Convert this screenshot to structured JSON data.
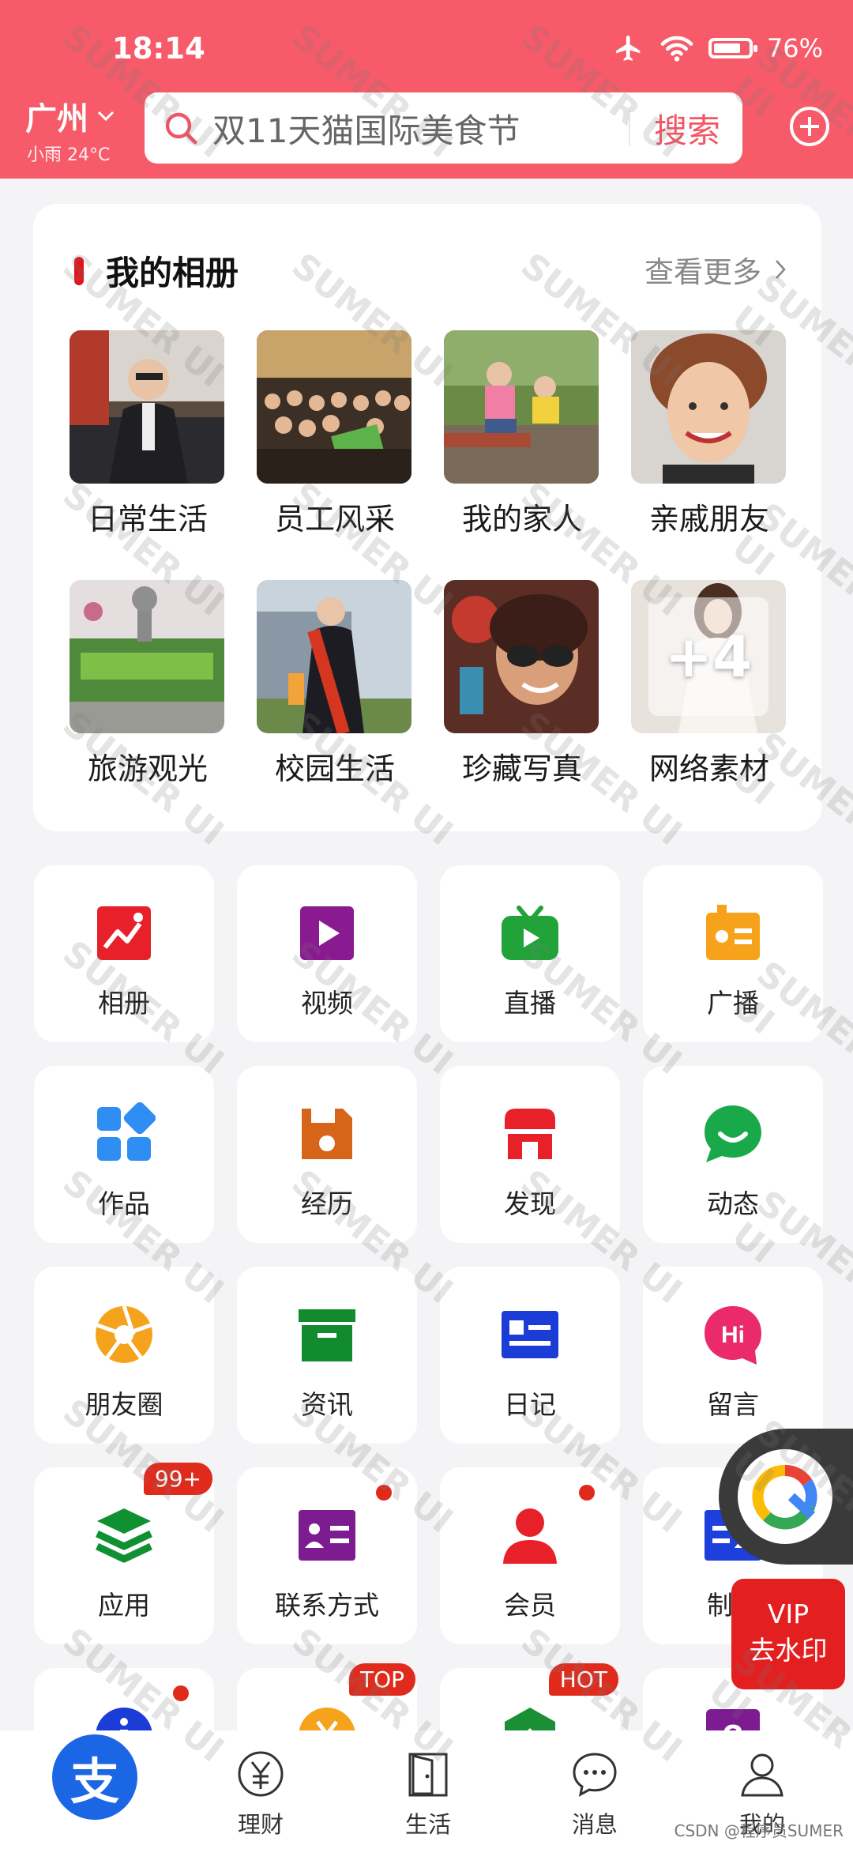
{
  "status_bar": {
    "time": "18:14",
    "battery": "76%",
    "battery_level": 0.76
  },
  "header": {
    "city": "广州",
    "weather": "小雨 24°C",
    "search_placeholder": "双11天猫国际美食节",
    "search_button": "搜索"
  },
  "album": {
    "title": "我的相册",
    "more": "查看更多",
    "items": [
      {
        "label": "日常生活"
      },
      {
        "label": "员工风采"
      },
      {
        "label": "我的家人"
      },
      {
        "label": "亲戚朋友"
      },
      {
        "label": "旅游观光"
      },
      {
        "label": "校园生活"
      },
      {
        "label": "珍藏写真"
      },
      {
        "label": "网络素材",
        "overlay": "+4"
      }
    ]
  },
  "grid": {
    "items": [
      {
        "label": "相册",
        "icon": "album-icon",
        "color": "#e8202a"
      },
      {
        "label": "视频",
        "icon": "video-icon",
        "color": "#8a1a8f"
      },
      {
        "label": "直播",
        "icon": "live-tv-icon",
        "color": "#22a33a"
      },
      {
        "label": "广播",
        "icon": "radio-icon",
        "color": "#f7a21b"
      },
      {
        "label": "作品",
        "icon": "works-icon",
        "color": "#2f8ef3"
      },
      {
        "label": "经历",
        "icon": "save-disk-icon",
        "color": "#d6651a"
      },
      {
        "label": "发现",
        "icon": "shop-icon",
        "color": "#e8202a"
      },
      {
        "label": "动态",
        "icon": "chat-bubble-icon",
        "color": "#1aa94a"
      },
      {
        "label": "朋友圈",
        "icon": "aperture-icon",
        "color": "#f5a31c"
      },
      {
        "label": "资讯",
        "icon": "archive-box-icon",
        "color": "#128b2e"
      },
      {
        "label": "日记",
        "icon": "id-card-icon",
        "color": "#1b3cd6"
      },
      {
        "label": "留言",
        "icon": "hi-bubble-icon",
        "color": "#ea2a6a"
      },
      {
        "label": "应用",
        "icon": "layers-icon",
        "color": "#0f9132",
        "badge": "99+"
      },
      {
        "label": "联系方式",
        "icon": "contact-card-icon",
        "color": "#7d1b90",
        "dot": true
      },
      {
        "label": "会员",
        "icon": "member-icon",
        "color": "#e8202a",
        "dot": true
      },
      {
        "label": "制作",
        "icon": "team-card-icon",
        "color": "#1d3fdc"
      },
      {
        "label": "",
        "icon": "info-icon",
        "color": "#1b3cd6",
        "dot": true
      },
      {
        "label": "",
        "icon": "coin-icon",
        "color": "#f5a31c",
        "badge": "TOP"
      },
      {
        "label": "",
        "icon": "hexagon-icon",
        "color": "#1a8f36",
        "badge": "HOT"
      },
      {
        "label": "",
        "icon": "question-icon",
        "color": "#7d1b90"
      }
    ]
  },
  "floating": {
    "vip_line1": "VIP",
    "vip_line2": "去水印"
  },
  "bottom_nav": {
    "items": [
      {
        "label": "",
        "icon": "alipay-home-icon"
      },
      {
        "label": "理财",
        "icon": "finance-yen-icon"
      },
      {
        "label": "生活",
        "icon": "door-icon"
      },
      {
        "label": "消息",
        "icon": "message-icon"
      },
      {
        "label": "我的",
        "icon": "user-icon"
      }
    ],
    "home_glyph": "支"
  },
  "footer_note": "CSDN @程序员SUMER",
  "watermark": "SUMER UI"
}
